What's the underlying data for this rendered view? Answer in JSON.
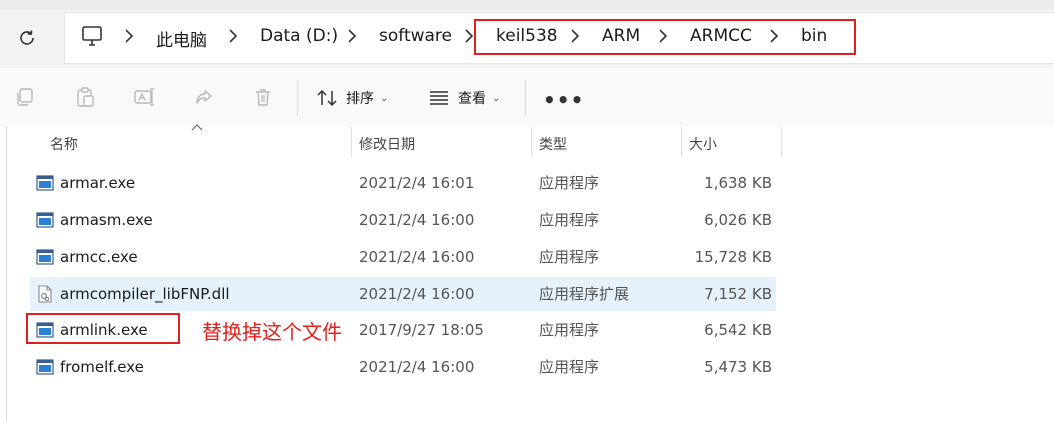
{
  "breadcrumb": {
    "computer_icon": "monitor-icon",
    "items": [
      "此电脑",
      "Data (D:)",
      "software",
      "keil538",
      "ARM",
      "ARMCC",
      "bin"
    ]
  },
  "toolbar": {
    "sort_label": "排序",
    "view_label": "查看",
    "more_label": "•••",
    "icons": [
      "copy-icon",
      "paste-icon",
      "rename-icon",
      "share-icon",
      "delete-icon"
    ]
  },
  "columns": {
    "name": "名称",
    "modified": "修改日期",
    "type": "类型",
    "size": "大小"
  },
  "files": [
    {
      "name": "armar.exe",
      "modified": "2021/2/4 16:01",
      "type": "应用程序",
      "size": "1,638 KB",
      "icon": "exe-icon"
    },
    {
      "name": "armasm.exe",
      "modified": "2021/2/4 16:00",
      "type": "应用程序",
      "size": "6,026 KB",
      "icon": "exe-icon"
    },
    {
      "name": "armcc.exe",
      "modified": "2021/2/4 16:00",
      "type": "应用程序",
      "size": "15,728 KB",
      "icon": "exe-icon"
    },
    {
      "name": "armcompiler_libFNP.dll",
      "modified": "2021/2/4 16:00",
      "type": "应用程序扩展",
      "size": "7,152 KB",
      "icon": "dll-icon"
    },
    {
      "name": "armlink.exe",
      "modified": "2017/9/27 18:05",
      "type": "应用程序",
      "size": "6,542 KB",
      "icon": "exe-icon"
    },
    {
      "name": "fromelf.exe",
      "modified": "2021/2/4 16:00",
      "type": "应用程序",
      "size": "5,473 KB",
      "icon": "exe-icon"
    }
  ],
  "annotation": {
    "text": "替换掉这个文件",
    "color": "#e0201b"
  },
  "colors": {
    "selected_row": "#e5f1fb",
    "annotation_red": "#e0201b"
  }
}
